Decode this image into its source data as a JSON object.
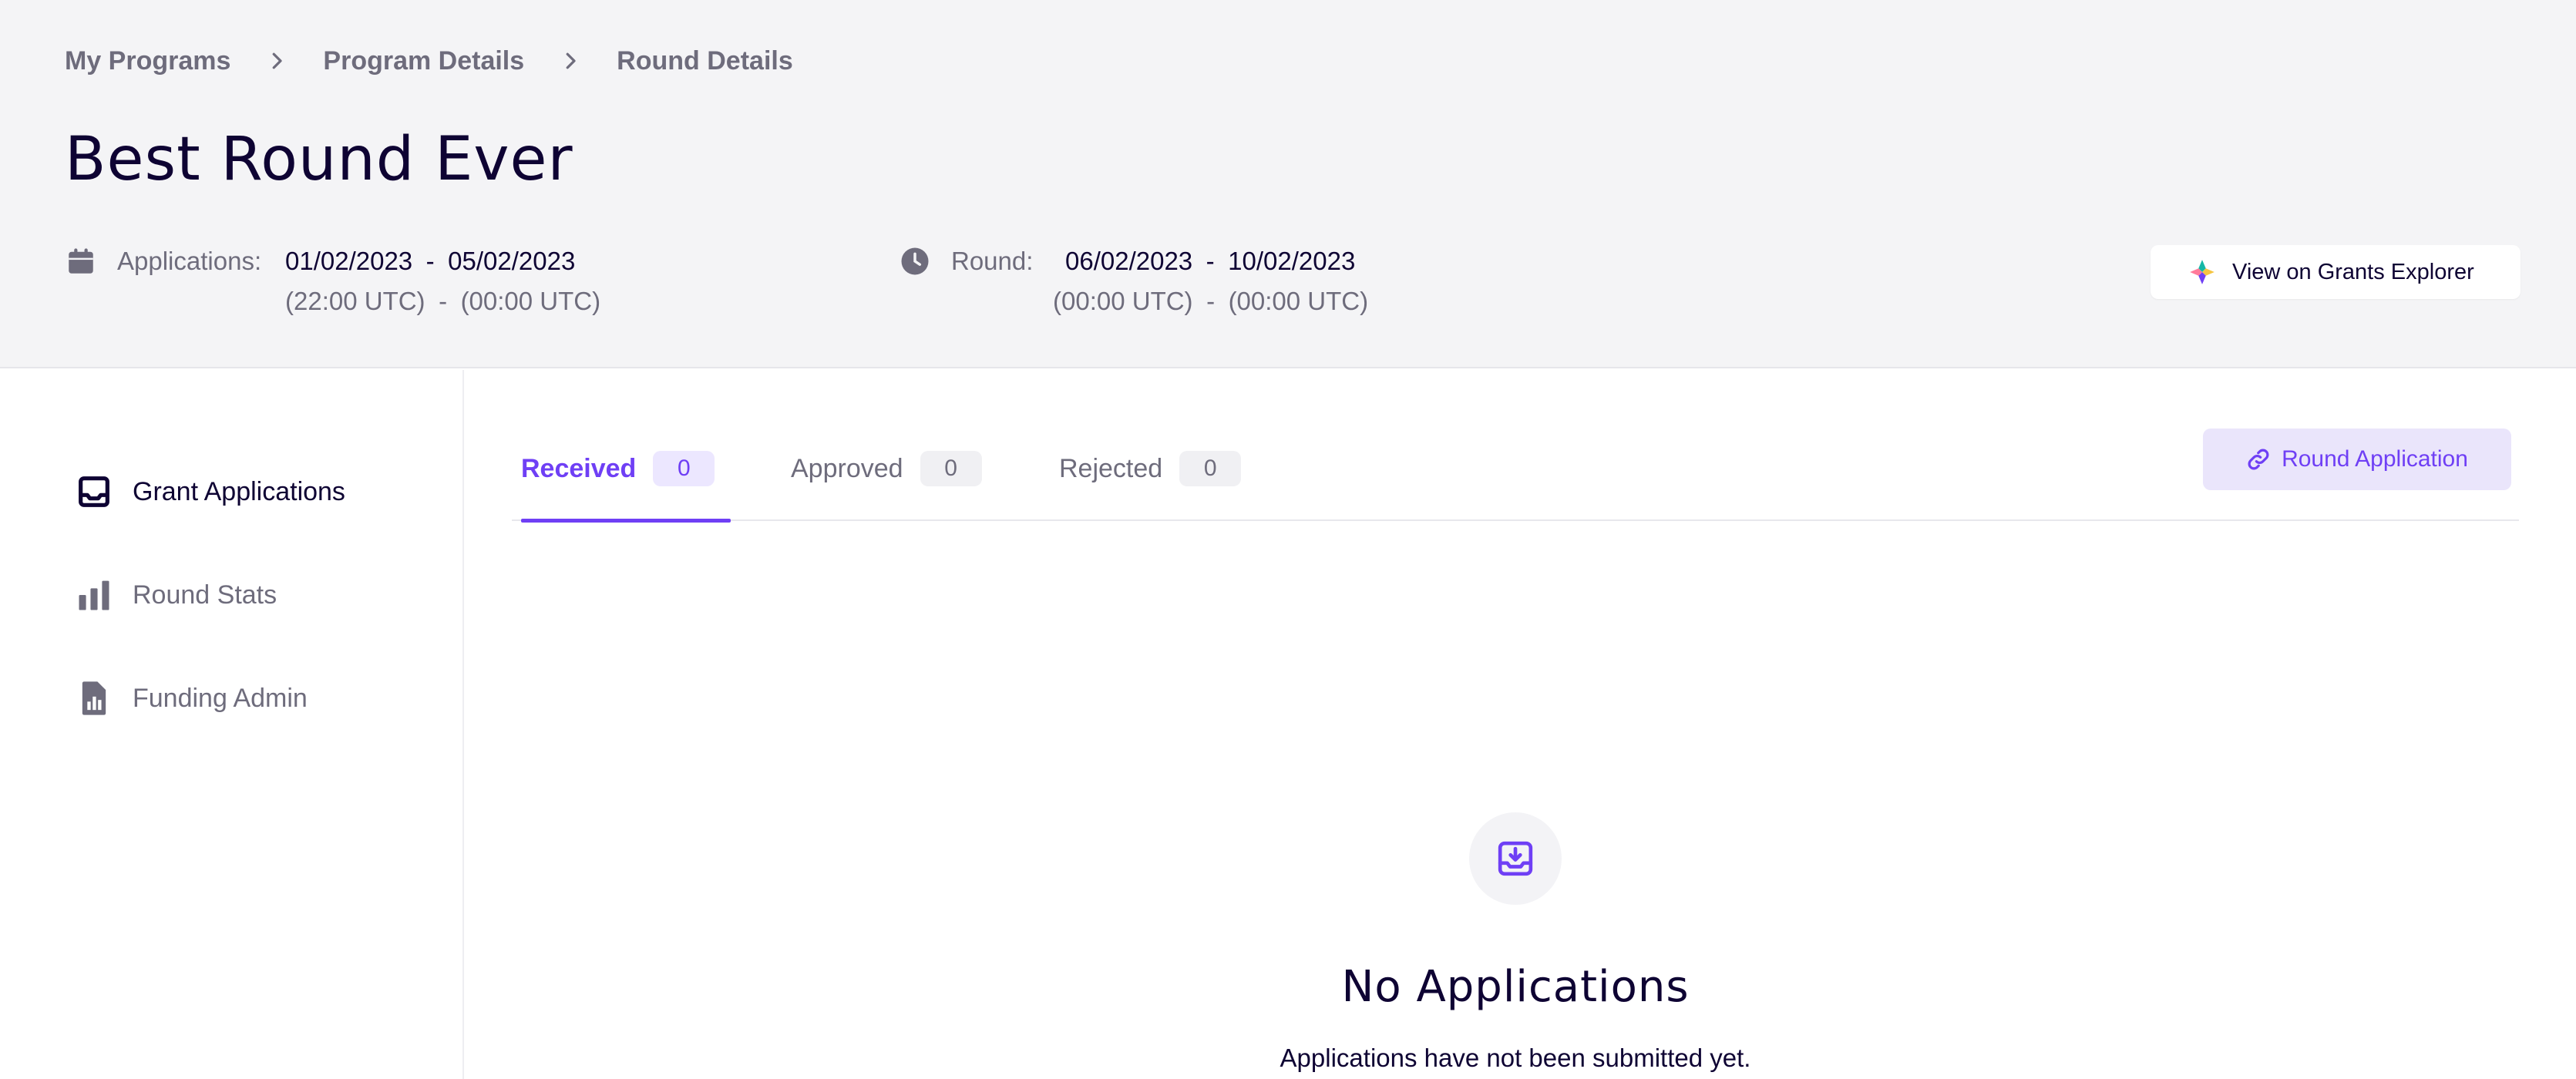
{
  "breadcrumb": [
    "My Programs",
    "Program Details",
    "Round Details"
  ],
  "round": {
    "title": "Best Round Ever",
    "applications": {
      "label": "Applications:",
      "start_date": "01/02/2023",
      "end_date": "05/02/2023",
      "start_time": "(22:00 UTC)",
      "end_time": "(00:00 UTC)"
    },
    "round_period": {
      "label": "Round:",
      "start_date": "06/02/2023",
      "end_date": "10/02/2023",
      "start_time": "(00:00 UTC)",
      "end_time": "(00:00 UTC)"
    },
    "separator": "-"
  },
  "actions": {
    "explorer_label": "View on Grants Explorer",
    "round_application_label": "Round Application"
  },
  "sidebar": {
    "items": [
      {
        "label": "Grant Applications",
        "icon": "inbox-icon",
        "active": true
      },
      {
        "label": "Round Stats",
        "icon": "bar-chart-icon",
        "active": false
      },
      {
        "label": "Funding Admin",
        "icon": "document-chart-icon",
        "active": false
      }
    ]
  },
  "tabs": [
    {
      "label": "Received",
      "count": "0",
      "active": true
    },
    {
      "label": "Approved",
      "count": "0",
      "active": false
    },
    {
      "label": "Rejected",
      "count": "0",
      "active": false
    }
  ],
  "empty_state": {
    "icon": "inbox-download-icon",
    "title": "No Applications",
    "subtitle": "Applications have not been submitted yet."
  },
  "colors": {
    "accent": "#6f3ff5",
    "text_primary": "#0e0333",
    "text_secondary": "#6e6c7c",
    "header_bg": "#f4f4f6"
  }
}
